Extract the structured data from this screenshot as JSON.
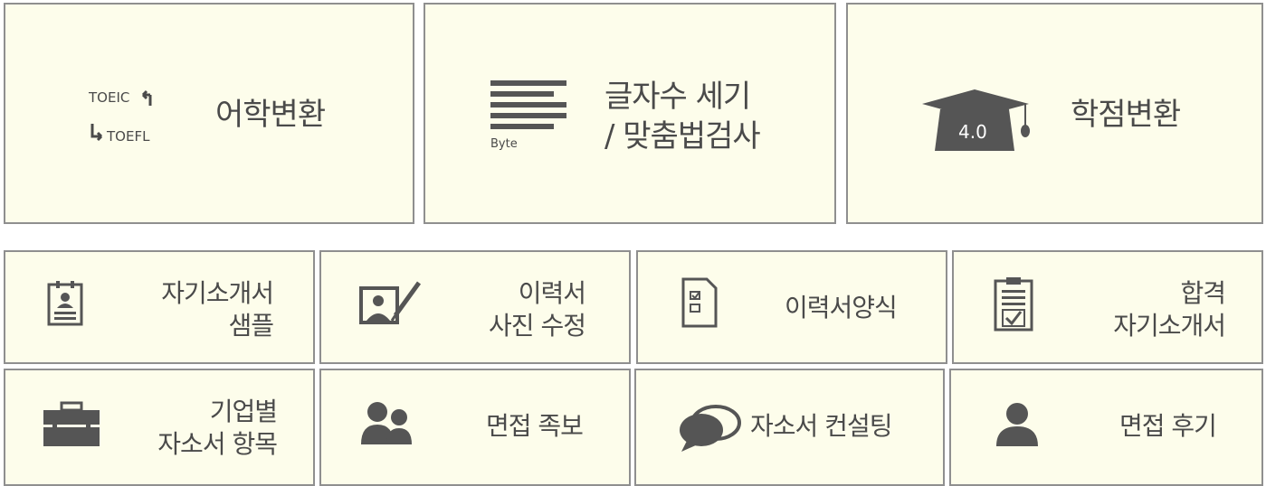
{
  "colors": {
    "tile_bg": "#fdfdeb",
    "border": "#8f8f8f",
    "icon": "#555555",
    "text": "#4a4a4a"
  },
  "top_tiles": {
    "language": {
      "icon": "toeic-toefl-icon",
      "icon_text_top": "TOEIC",
      "icon_text_bottom": "TOEFL",
      "label": "어학변환"
    },
    "charcount": {
      "icon": "byte-lines-icon",
      "icon_text": "Byte",
      "label_line1": "글자수 세기",
      "label_line2": "/ 맞춤법검사"
    },
    "gpa": {
      "icon": "graduation-cap-icon",
      "icon_text": "4.0",
      "label": "학점변환"
    }
  },
  "row2": {
    "sample": {
      "icon": "id-badge-icon",
      "line1": "자기소개서",
      "line2": "샘플"
    },
    "photo": {
      "icon": "photo-edit-icon",
      "line1": "이력서",
      "line2": "사진 수정"
    },
    "form": {
      "icon": "resume-form-icon",
      "line1": "이력서양식"
    },
    "passed": {
      "icon": "clipboard-check-icon",
      "line1": "합격",
      "line2": "자기소개서"
    }
  },
  "row3": {
    "company": {
      "icon": "briefcase-icon",
      "line1": "기업별",
      "line2": "자소서 항목"
    },
    "interview_tips": {
      "icon": "people-icon",
      "line1": "면접 족보"
    },
    "consulting": {
      "icon": "chat-bubbles-icon",
      "line1": "자소서 컨설팅"
    },
    "reviews": {
      "icon": "person-icon",
      "line1": "면접 후기"
    }
  }
}
